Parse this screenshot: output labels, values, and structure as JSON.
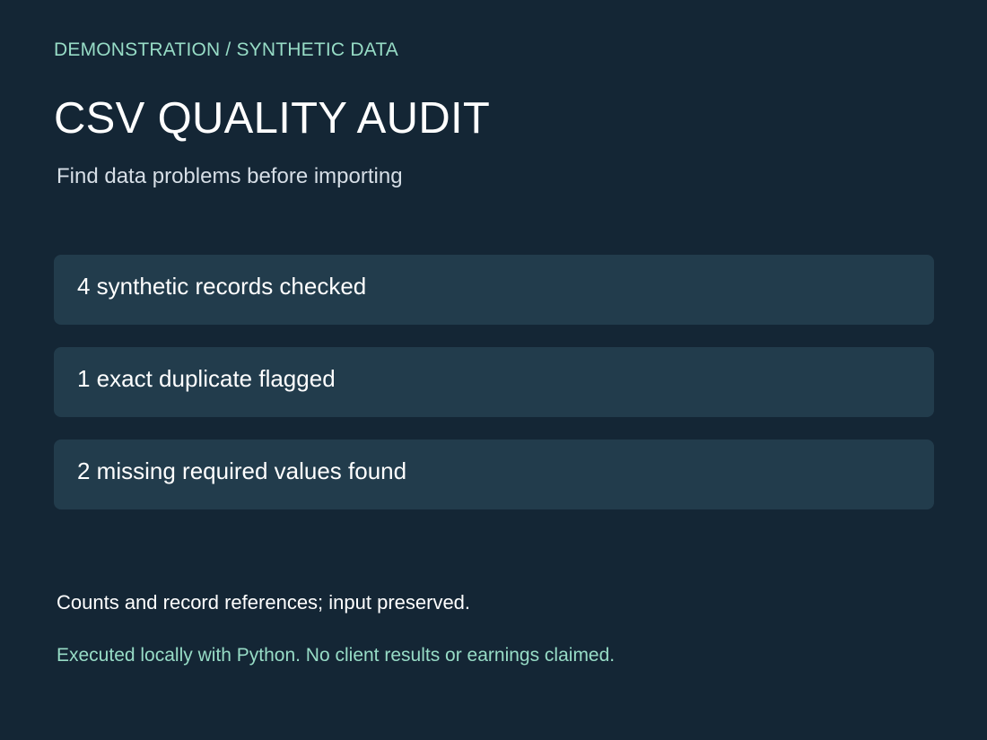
{
  "header": {
    "eyebrow": "DEMONSTRATION / SYNTHETIC DATA",
    "title": "CSV QUALITY AUDIT",
    "subtitle": "Find data problems before importing"
  },
  "findings": [
    "4 synthetic records checked",
    "1 exact duplicate flagged",
    "2 missing required values found"
  ],
  "footer": {
    "note": "Counts and record references; input preserved.",
    "disclaimer": "Executed locally with Python. No client results or earnings claimed."
  },
  "colors": {
    "background": "#142635",
    "card": "#223c4c",
    "accent": "#97dcc6",
    "text": "#ffffff"
  }
}
